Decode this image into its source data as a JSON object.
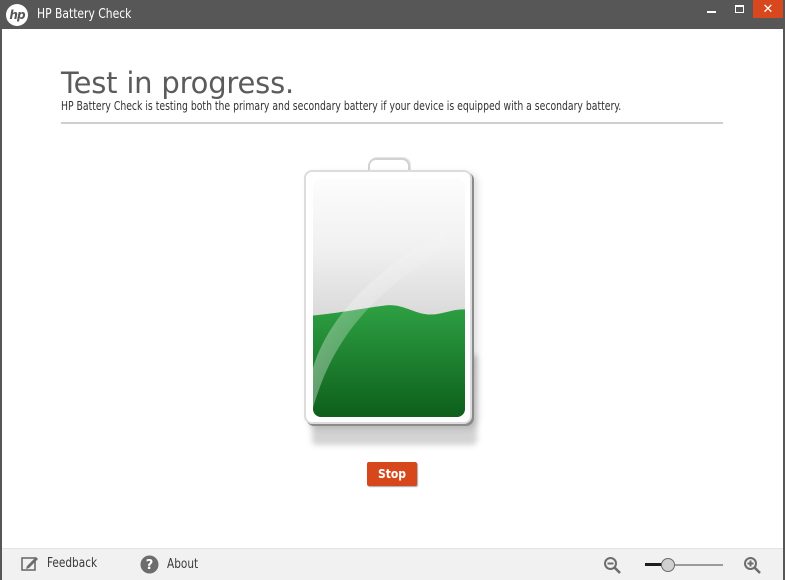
{
  "window": {
    "title": "HP Battery Check",
    "logo_text": "hp",
    "close_glyph": "✕",
    "accent_close": "#d8471d"
  },
  "main": {
    "heading": "Test in progress.",
    "description": "HP Battery Check is testing both the primary and secondary battery if your device is equipped with a secondary battery.",
    "battery": {
      "icon": "battery-icon",
      "fill_fraction": 0.45,
      "fill_color_top": "#2ea043",
      "fill_color_bottom": "#0d5f1b"
    },
    "stop_label": "Stop",
    "stop_color": "#d6481b"
  },
  "footer": {
    "feedback_label": "Feedback",
    "feedback_icon": "feedback-icon",
    "about_label": "About",
    "about_icon": "help-icon",
    "zoom_out_icon": "zoom-out-icon",
    "zoom_in_icon": "zoom-in-icon",
    "zoom_level_fraction": 0.3
  }
}
